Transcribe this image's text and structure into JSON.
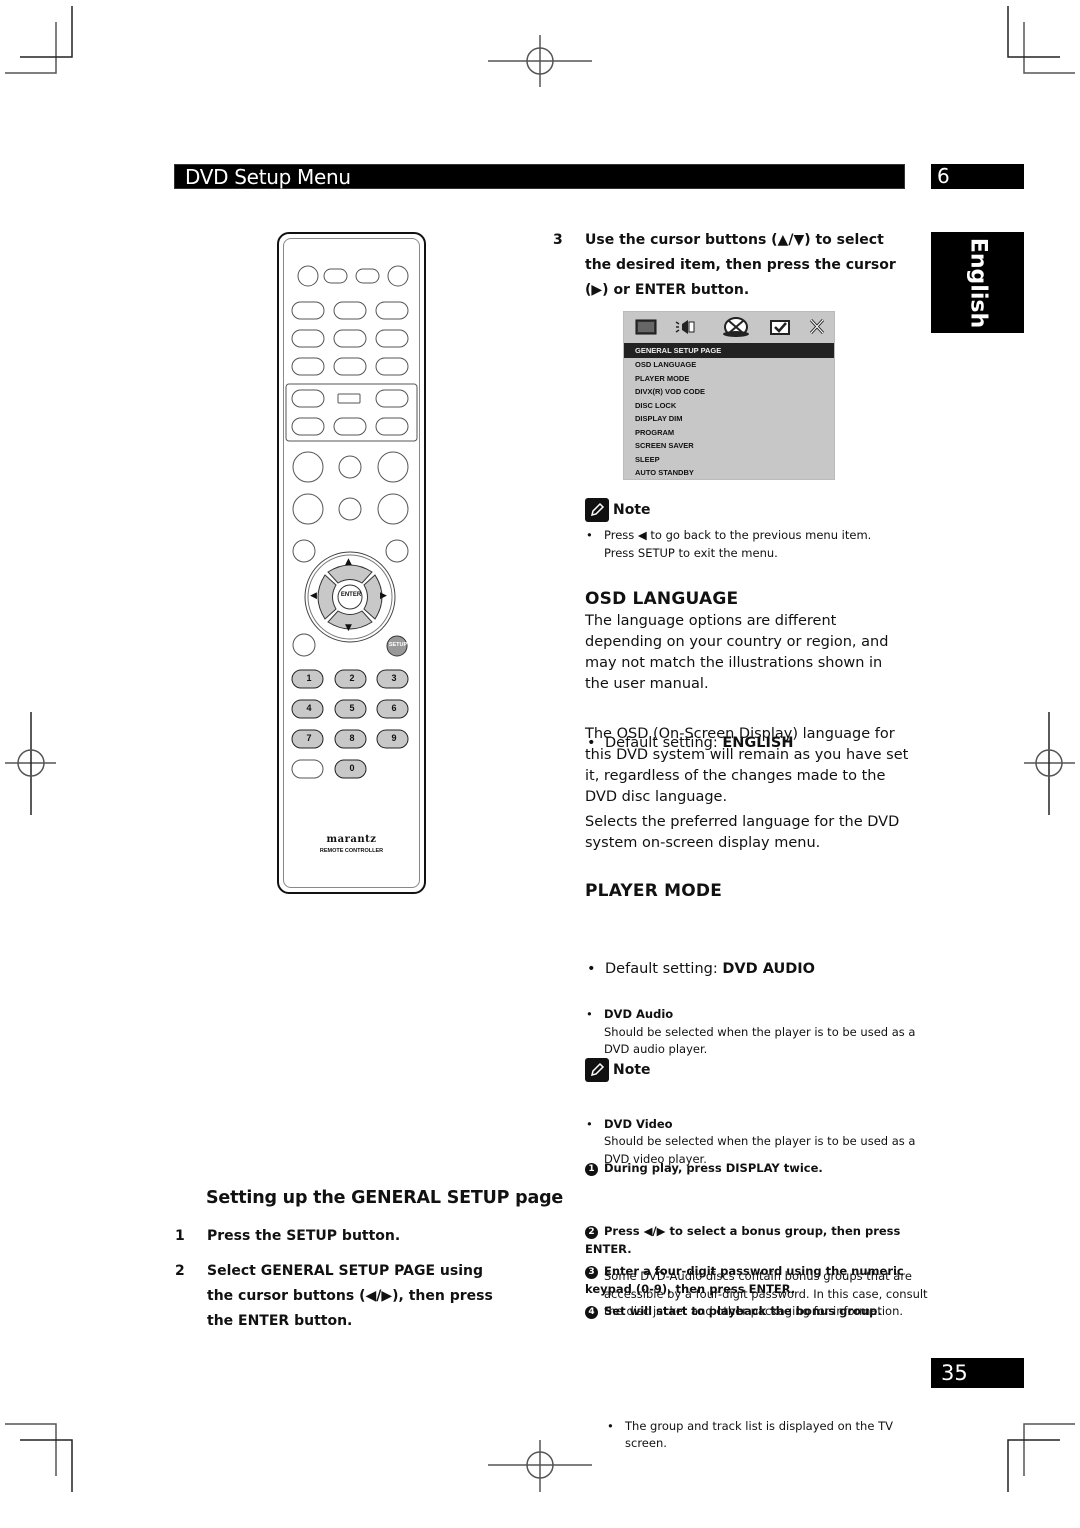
{
  "header": {
    "section_title": "DVD Setup Menu",
    "chapter_number": "6",
    "language_tab": "English",
    "page_number": "35"
  },
  "remote": {
    "nav_enter_label": "ENTER",
    "setup_label": "SETUP",
    "number_keys": [
      "1",
      "2",
      "3",
      "4",
      "5",
      "6",
      "7",
      "8",
      "9",
      "0"
    ],
    "brand": "marantz",
    "subtitle": "REMOTE CONTROLLER",
    "arrows": {
      "up": "▲",
      "down": "▼",
      "left": "◀",
      "right": "▶"
    }
  },
  "left_section": {
    "heading": "Setting up the GENERAL SETUP page",
    "steps": [
      {
        "num": "1",
        "text": "Press the SETUP button."
      },
      {
        "num": "2",
        "text": "Select GENERAL SETUP PAGE using the cursor buttons (◀/▶), then press the ENTER button."
      }
    ]
  },
  "right_section": {
    "step3": {
      "num": "3",
      "text": "Use the cursor buttons (▲/▼) to select the desired item, then press the cursor (▶) or ENTER button."
    },
    "osd_menu": {
      "icons": [
        "monitor-icon",
        "speaker-icon",
        "disc-icon",
        "checkbox-icon",
        "close-icon"
      ],
      "items": [
        {
          "label": "GENERAL SETUP PAGE",
          "selected": true
        },
        {
          "label": "OSD LANGUAGE",
          "selected": false
        },
        {
          "label": "PLAYER MODE",
          "selected": false
        },
        {
          "label": "DIVX(R) VOD CODE",
          "selected": false
        },
        {
          "label": "DISC LOCK",
          "selected": false
        },
        {
          "label": "DISPLAY DIM",
          "selected": false
        },
        {
          "label": "PROGRAM",
          "selected": false
        },
        {
          "label": "SCREEN SAVER",
          "selected": false
        },
        {
          "label": "SLEEP",
          "selected": false
        },
        {
          "label": "AUTO STANDBY",
          "selected": false
        }
      ]
    },
    "note1": {
      "title": "Note",
      "lines": [
        "Press ◀ to go back to the previous menu item.",
        "Press SETUP to exit the menu."
      ]
    },
    "osd_language": {
      "heading": "OSD LANGUAGE",
      "para1": "The language options are different depending on your country or region, and may not match the illustrations shown in the user manual.",
      "default_prefix": "Default setting: ",
      "default_value": "ENGLISH",
      "para2": "The OSD (On-Screen Display) language for this DVD system will remain as you have set it, regardless of the changes made to the DVD disc language.",
      "para3": "Selects the preferred language for the DVD system on-screen display menu."
    },
    "player_mode": {
      "heading": "PLAYER MODE",
      "default_prefix": "Default setting: ",
      "default_value": "DVD AUDIO",
      "options": [
        {
          "title": "DVD Audio",
          "desc": "Should be selected when the player is to be used as a DVD audio player."
        },
        {
          "title": "DVD Video",
          "desc": "Should be selected when the player is to be used as a DVD video player."
        }
      ]
    },
    "note2": {
      "title": "Note",
      "text": "Some DVD-Audio discs contain bonus groups that are accessible by a four-digit password. In this case, consult the disc jacket and other packaging for information.",
      "steps": [
        {
          "num": "1",
          "text": "During play, press DISPLAY twice.",
          "sub": "The group and track list is displayed on the TV screen."
        },
        {
          "num": "2",
          "text": "Press ◀/▶ to select a bonus group, then press ENTER."
        },
        {
          "num": "3",
          "text": "Enter a four-digit password using the numeric keypad (0-9), then press ENTER."
        },
        {
          "num": "4",
          "text": "Set will start to playback the bonus group."
        }
      ]
    }
  }
}
